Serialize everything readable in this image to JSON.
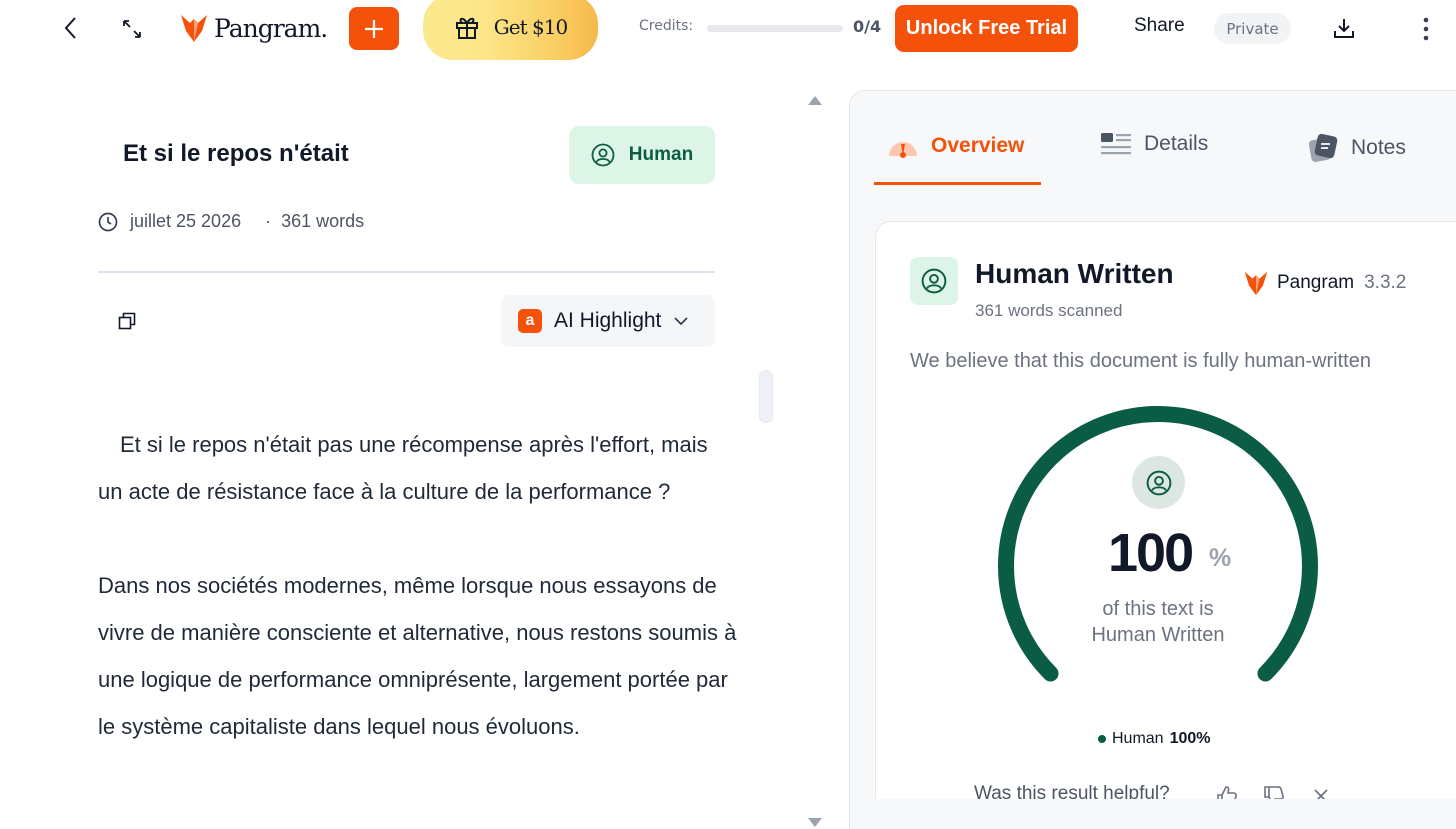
{
  "topbar": {
    "logo_text": "Pangram.",
    "gift_label": "Get $10",
    "credits_label": "Credits:",
    "credits_count": "0/4",
    "credits_fraction": 0,
    "unlock_label": "Unlock Free Trial",
    "share_label": "Share",
    "private_label": "Private"
  },
  "document": {
    "title": "Et si le repos n'était",
    "badge_label": "Human",
    "date": "juillet 25 2026",
    "separator": "·",
    "word_count": "361 words",
    "highlight_label": "AI Highlight",
    "highlight_logo": "a",
    "paragraphs": [
      "Et si le repos n'était pas une récompense après l'effort, mais un acte de résistance face à la culture de la performance ?",
      "Dans nos sociétés modernes, même lorsque nous essayons de vivre de manière consciente et alternative, nous restons soumis à une logique de performance omniprésente, largement portée par le système capitaliste dans lequel nous évoluons."
    ]
  },
  "panel": {
    "tabs": [
      {
        "label": "Overview",
        "icon": "gauge-icon"
      },
      {
        "label": "Details",
        "icon": "list-icon"
      },
      {
        "label": "Notes",
        "icon": "notes-icon"
      }
    ],
    "result_title": "Human Written",
    "words_scanned": "361 words scanned",
    "brand_name": "Pangram",
    "brand_version": "3.3.2",
    "description": "We believe that this document is fully human-written",
    "gauge_value": "100",
    "gauge_unit": "%",
    "gauge_fraction": 1.0,
    "caption_line1": "of this text is",
    "caption_line2": "Human Written",
    "legend_name": "Human",
    "legend_value": "100%",
    "feedback_question": "Was this result helpful?"
  },
  "colors": {
    "accent": "#f4520b",
    "human_green": "#0a5c45",
    "badge_bg": "#dcf5e7"
  }
}
